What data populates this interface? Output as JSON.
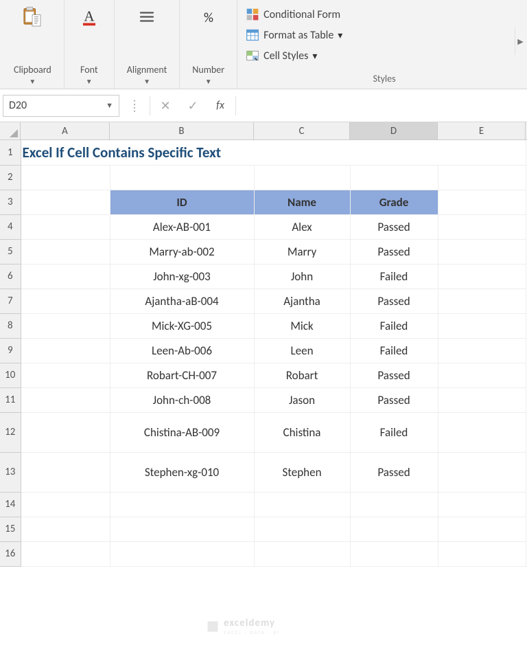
{
  "ribbon": {
    "clipboard": {
      "label": "Clipboard"
    },
    "font": {
      "label": "Font"
    },
    "alignment": {
      "label": "Alignment"
    },
    "number": {
      "label": "Number"
    },
    "styles": {
      "conditional": "Conditional Form",
      "format_table": "Format as Table",
      "cell_styles": "Cell Styles",
      "group_label": "Styles"
    }
  },
  "formula_bar": {
    "cell_ref": "D20",
    "formula": ""
  },
  "columns": [
    "A",
    "B",
    "C",
    "D",
    "E"
  ],
  "rows": [
    "1",
    "2",
    "3",
    "4",
    "5",
    "6",
    "7",
    "8",
    "9",
    "10",
    "11",
    "12",
    "13",
    "14",
    "15",
    "16"
  ],
  "title": "Excel If Cell Contains Specific Text",
  "table": {
    "headers": {
      "id": "ID",
      "name": "Name",
      "grade": "Grade"
    },
    "rows": [
      {
        "id": "Alex-AB-001",
        "name": "Alex",
        "grade": "Passed"
      },
      {
        "id": "Marry-ab-002",
        "name": "Marry",
        "grade": "Passed"
      },
      {
        "id": "John-xg-003",
        "name": "John",
        "grade": "Failed"
      },
      {
        "id": "Ajantha-aB-004",
        "name": "Ajantha",
        "grade": "Passed"
      },
      {
        "id": "Mick-XG-005",
        "name": "Mick",
        "grade": "Failed"
      },
      {
        "id": "Leen-Ab-006",
        "name": "Leen",
        "grade": "Failed"
      },
      {
        "id": "Robart-CH-007",
        "name": "Robart",
        "grade": "Passed"
      },
      {
        "id": "John-ch-008",
        "name": "Jason",
        "grade": "Passed"
      },
      {
        "id": "Chistina-AB-009",
        "name": "Chistina",
        "grade": "Failed"
      },
      {
        "id": "Stephen-xg-010",
        "name": "Stephen",
        "grade": "Passed"
      }
    ]
  },
  "watermark": {
    "brand": "exceldemy",
    "sub": "EXCEL · DATA · BI"
  }
}
